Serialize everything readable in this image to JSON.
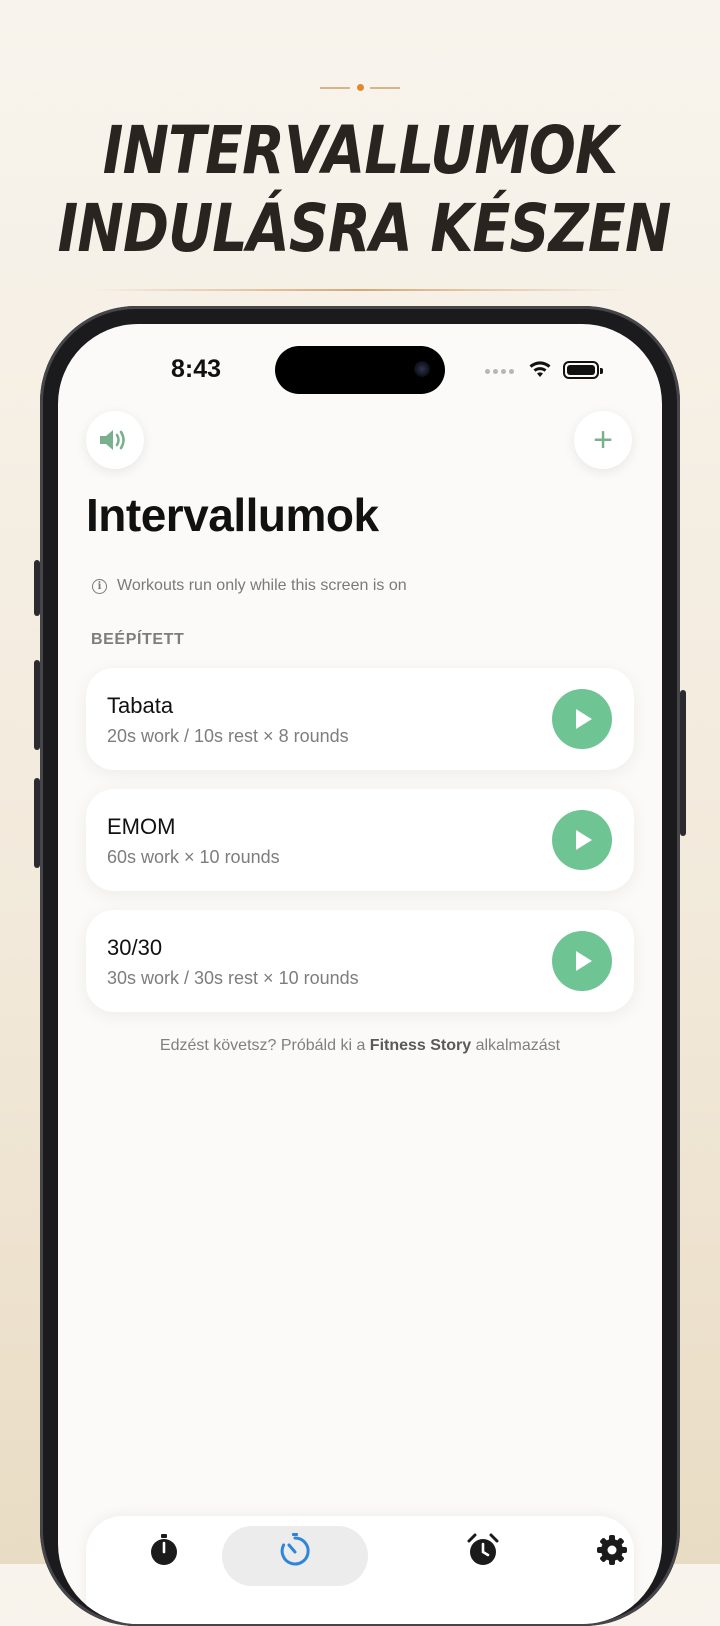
{
  "promo_headline": {
    "line1": "INTERVALLUMOK",
    "line2": "INDULÁSRA KÉSZEN"
  },
  "status_bar": {
    "time": "8:43"
  },
  "header": {
    "sound_icon": "speaker-icon",
    "add_icon": "plus-icon",
    "add_label": "+",
    "title": "Intervallumok"
  },
  "notice": {
    "text": "Workouts run only while this screen is on",
    "icon": "info-icon"
  },
  "section": {
    "label": "BEÉPÍTETT"
  },
  "workouts": [
    {
      "name": "Tabata",
      "detail": "20s work / 10s rest × 8 rounds"
    },
    {
      "name": "EMOM",
      "detail": "60s work × 10 rounds"
    },
    {
      "name": "30/30",
      "detail": "30s work / 30s rest × 10 rounds"
    }
  ],
  "promo": {
    "prefix": "Edzést követsz? Próbáld ki a ",
    "app_name": "Fitness Story",
    "suffix": " alkalmazást"
  },
  "tabbar": {
    "tabs": [
      {
        "icon": "stopwatch-icon",
        "active": false
      },
      {
        "icon": "interval-timer-icon",
        "active": true
      },
      {
        "icon": "alarm-clock-icon",
        "active": false
      },
      {
        "icon": "gear-icon",
        "active": false
      }
    ]
  },
  "colors": {
    "accent_green": "#6fc493",
    "plus_green": "#7bb08e",
    "active_tab_blue": "#2f86d8",
    "headline": "#2a2420"
  }
}
